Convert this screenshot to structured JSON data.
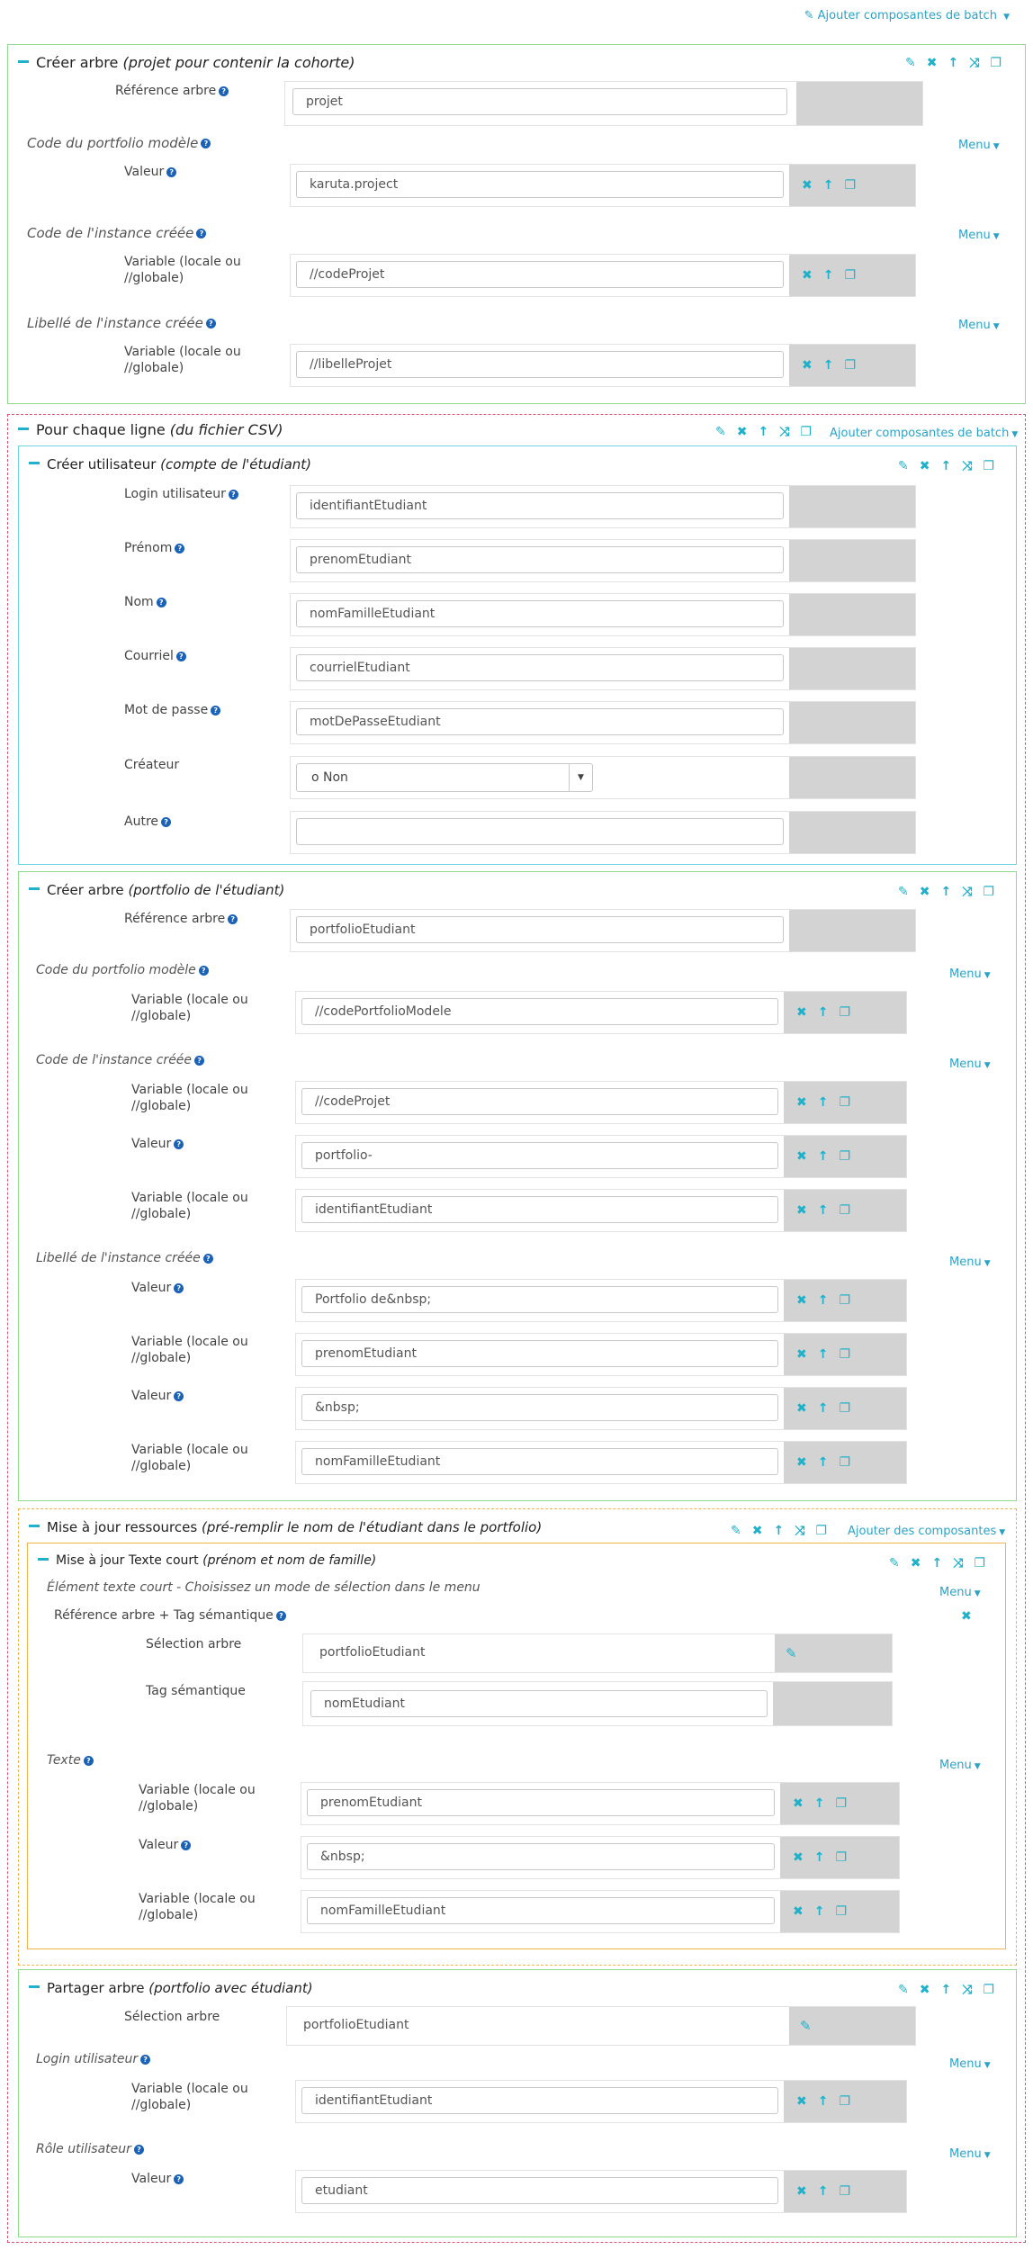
{
  "top_link": "Ajouter composantes de batch",
  "menu_label": "Menu",
  "colors": {
    "accent": "#1fb1c9",
    "green": "#8fdc8f",
    "cyan": "#6dd3e3",
    "orange": "#f3b24a",
    "dashed": "#e0536e",
    "gray": "#d3d3d3"
  },
  "b1": {
    "title": "Créer arbre",
    "title_it": "(projet pour contenir la cohorte)",
    "ref_label": "Référence arbre",
    "ref_value": "projet",
    "s1": "Code du portfolio modèle",
    "s1_label": "Valeur",
    "s1_value": "karuta.project",
    "s2": "Code de l'instance créée",
    "s2_label": "Variable (locale ou //globale)",
    "s2_value": "//codeProjet",
    "s3": "Libellé de l'instance créée",
    "s3_label": "Variable (locale ou //globale)",
    "s3_value": "//libelleProjet"
  },
  "loop": {
    "title": "Pour chaque ligne",
    "title_it": "(du fichier CSV)",
    "link": "Ajouter composantes de batch"
  },
  "user": {
    "title": "Créer utilisateur",
    "title_it": "(compte de l'étudiant)",
    "fields": [
      {
        "label": "Login utilisateur",
        "value": "identifiantEtudiant"
      },
      {
        "label": "Prénom",
        "value": "prenomEtudiant"
      },
      {
        "label": "Nom",
        "value": "nomFamilleEtudiant"
      },
      {
        "label": "Courriel",
        "value": "courrielEtudiant"
      },
      {
        "label": "Mot de passe",
        "value": "motDePasseEtudiant"
      }
    ],
    "creator_label": "Créateur",
    "creator_value": "o Non",
    "other_label": "Autre",
    "other_value": ""
  },
  "tree2": {
    "title": "Créer arbre",
    "title_it": "(portfolio de l'étudiant)",
    "ref_label": "Référence arbre",
    "ref_value": "portfolioEtudiant",
    "s1": "Code du portfolio modèle",
    "s1_label": "Variable (locale ou //globale)",
    "s1_value": "//codePortfolioModele",
    "s2": "Code de l'instance créée",
    "s2_rows": [
      {
        "label": "Variable (locale ou //globale)",
        "value": "//codeProjet"
      },
      {
        "label": "Valeur",
        "value": "portfolio-"
      },
      {
        "label": "Variable (locale ou //globale)",
        "value": "identifiantEtudiant"
      }
    ],
    "s3": "Libellé de l'instance créée",
    "s3_rows": [
      {
        "label": "Valeur",
        "value": "Portfolio de&nbsp;"
      },
      {
        "label": "Variable (locale ou //globale)",
        "value": "prenomEtudiant"
      },
      {
        "label": "Valeur",
        "value": "&nbsp;"
      },
      {
        "label": "Variable (locale ou //globale)",
        "value": "nomFamilleEtudiant"
      }
    ]
  },
  "update": {
    "title": "Mise à jour ressources",
    "title_it": "(pré-remplir le nom de l'étudiant dans le portfolio)",
    "link": "Ajouter des composantes",
    "inner_title": "Mise à jour Texte court",
    "inner_title_it": "(prénom et nom de famille)",
    "desc": "Élément texte court - Choisissez un mode de sélection dans le menu",
    "ref_tag": "Référence arbre + Tag sémantique",
    "sel_label": "Sélection arbre",
    "sel_value": "portfolioEtudiant",
    "tag_label": "Tag sémantique",
    "tag_value": "nomEtudiant",
    "texte": "Texte",
    "rows": [
      {
        "label": "Variable (locale ou //globale)",
        "value": "prenomEtudiant"
      },
      {
        "label": "Valeur",
        "value": "&nbsp;"
      },
      {
        "label": "Variable (locale ou //globale)",
        "value": "nomFamilleEtudiant"
      }
    ]
  },
  "share": {
    "title": "Partager arbre",
    "title_it": "(portfolio avec étudiant)",
    "sel_label": "Sélection arbre",
    "sel_value": "portfolioEtudiant",
    "s1": "Login utilisateur",
    "s1_label": "Variable (locale ou //globale)",
    "s1_value": "identifiantEtudiant",
    "s2": "Rôle utilisateur",
    "s2_label": "Valeur",
    "s2_value": "etudiant"
  }
}
